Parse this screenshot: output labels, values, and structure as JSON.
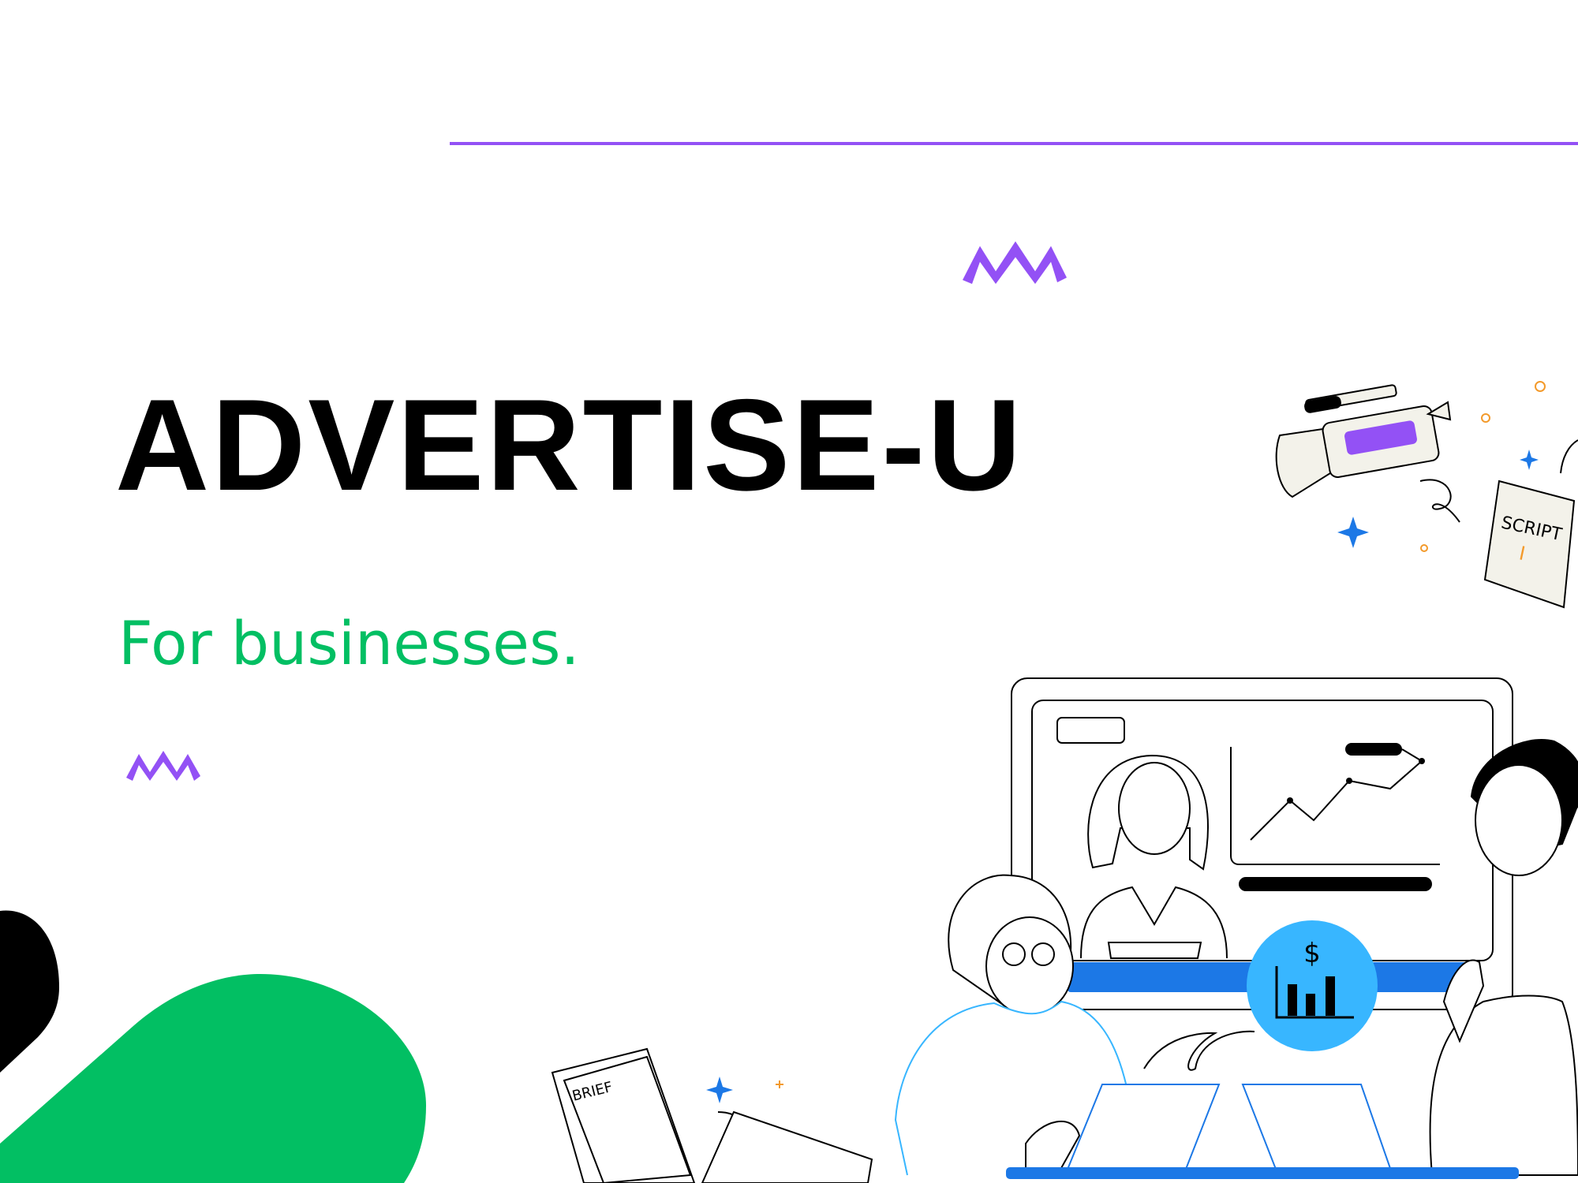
{
  "brand": {
    "title": "ADVERTISE-U",
    "tagline": "For businesses."
  },
  "illustration": {
    "script_label": "SCRIPT",
    "script_mark": "I",
    "brief_label": "BRIEF",
    "currency_symbol": "$"
  },
  "colors": {
    "accent_purple": "#9351f5",
    "accent_green": "#02bf63",
    "blue": "#1c78e6",
    "light_blue": "#38b6ff",
    "text": "#000000"
  },
  "icons": [
    "zigzag-icon",
    "video-camera-icon",
    "script-book-icon",
    "sparkle-icon",
    "chart-icon",
    "laptop-icon"
  ]
}
